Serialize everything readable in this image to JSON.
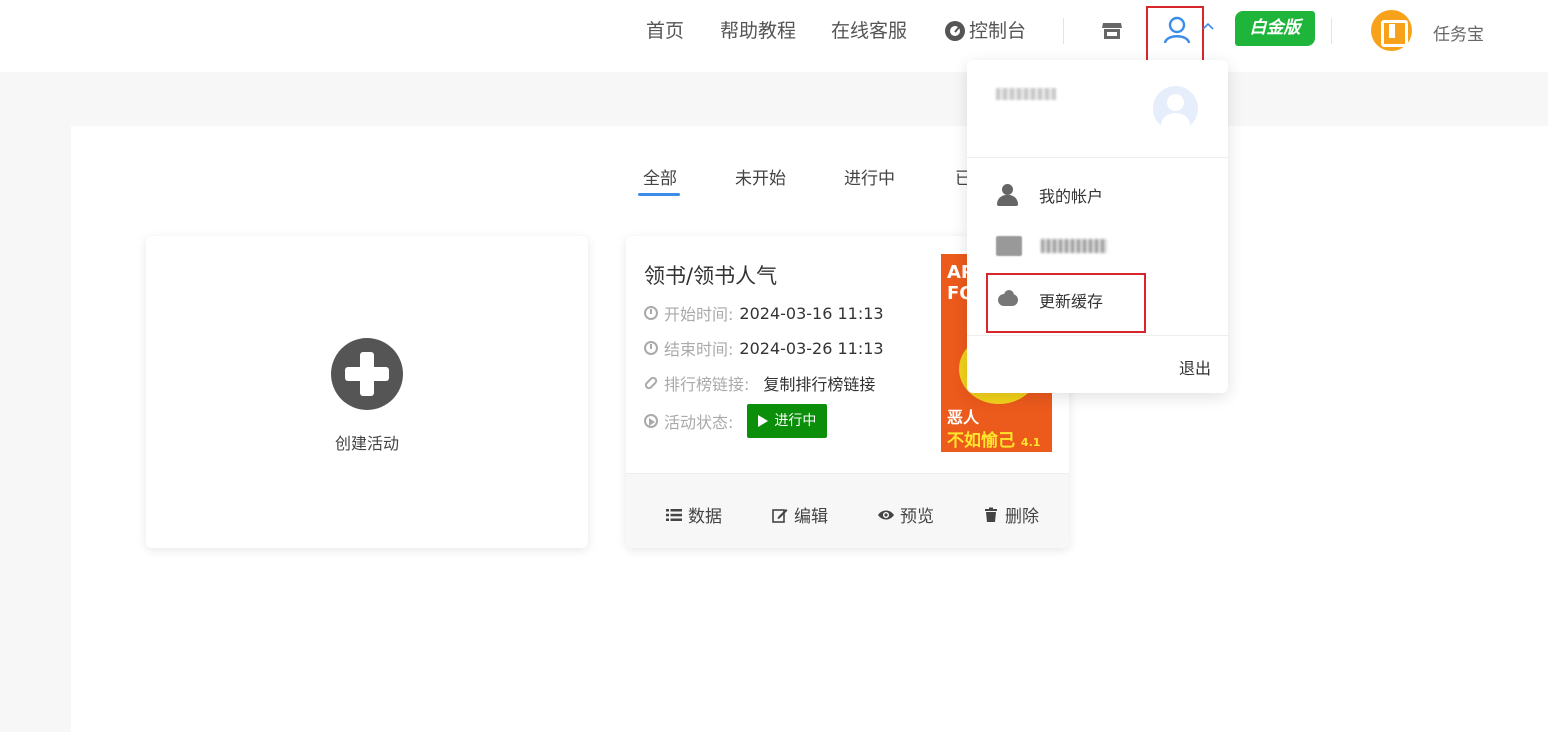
{
  "header": {
    "nav": [
      "首页",
      "帮助教程",
      "在线客服"
    ],
    "console_label": "控制台",
    "plan_badge": "白金版",
    "app_name": "任务宝"
  },
  "tabs": [
    "全部",
    "未开始",
    "进行中",
    "已"
  ],
  "create_card": {
    "label": "创建活动"
  },
  "activity": {
    "title": "领书/领书人气",
    "start_label": "开始时间:",
    "start_value": "2024-03-16 11:13",
    "end_label": "结束时间:",
    "end_value": "2024-03-26 11:13",
    "rank_label": "排行榜链接:",
    "rank_value": "复制排行榜链接",
    "status_label": "活动状态:",
    "status_value": "进行中",
    "poster_text": [
      "AP",
      "FO",
      "恶人",
      "不如愉己",
      "4.1"
    ],
    "actions": [
      "数据",
      "编辑",
      "预览",
      "删除"
    ]
  },
  "dropdown": {
    "items": [
      "我的帐户",
      "更新缓存"
    ],
    "logout": "退出"
  },
  "colors": {
    "accent": "#3b8ce8",
    "status_green": "#0b8f0b",
    "badge_green": "#1fb53a",
    "highlight_red": "#d9262c",
    "logo_orange": "#f7a21a"
  }
}
